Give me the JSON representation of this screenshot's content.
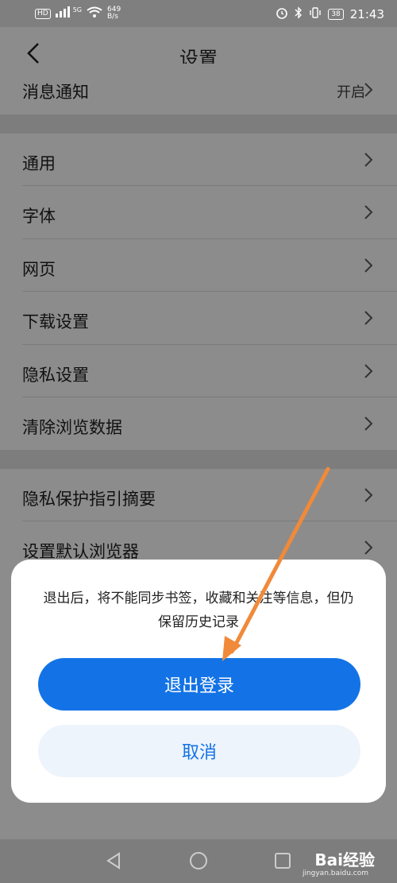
{
  "status_bar": {
    "badge_hd": "HD",
    "signal": "5G",
    "net_speed_value": "649",
    "net_speed_unit": "B/s",
    "battery": "38",
    "time": "21:43"
  },
  "header": {
    "title": "设置"
  },
  "top_row": {
    "label": "消息通知",
    "value": "开启"
  },
  "group1": [
    {
      "label": "通用"
    },
    {
      "label": "字体"
    },
    {
      "label": "网页"
    },
    {
      "label": "下载设置"
    },
    {
      "label": "隐私设置"
    },
    {
      "label": "清除浏览数据"
    }
  ],
  "group2": [
    {
      "label": "隐私保护指引摘要"
    },
    {
      "label": "设置默认浏览器"
    }
  ],
  "dialog": {
    "message": "退出后，将不能同步书签，收藏和关注等信息，但仍保留历史记录",
    "confirm_label": "退出登录",
    "cancel_label": "取消"
  },
  "watermark": {
    "brand": "Bai经验",
    "url": "jingyan.baidu.com"
  },
  "colors": {
    "primary": "#1373e6",
    "overlay": "#8c8c8c",
    "arrow": "#f08a3a"
  }
}
